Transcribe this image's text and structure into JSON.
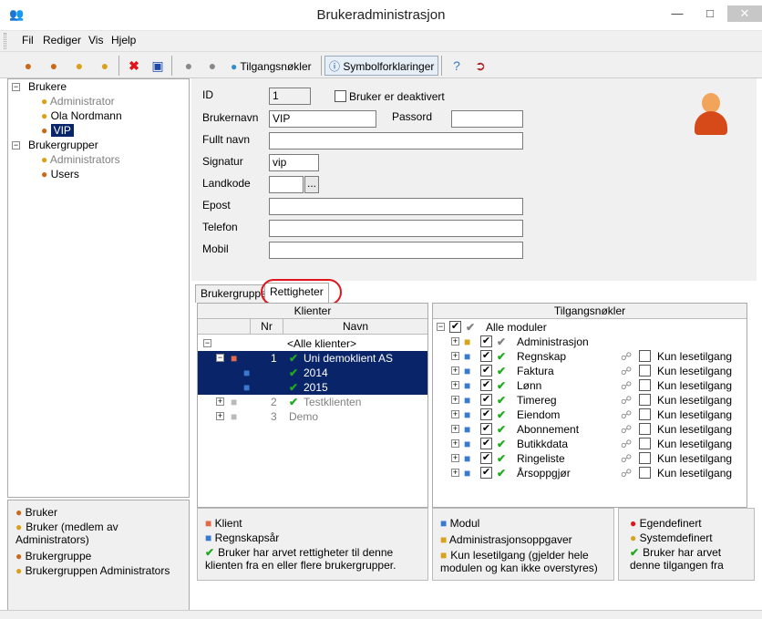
{
  "window": {
    "title": "Brukeradministrasjon"
  },
  "menu": {
    "items": [
      "Fil",
      "Rediger",
      "Vis",
      "Hjelp"
    ]
  },
  "toolbar": {
    "tilgangsnokler": "Tilgangsnøkler",
    "symbolforklaringer": "Symbolforklaringer"
  },
  "tree": {
    "brukere": "Brukere",
    "users": [
      "Administrator",
      "Ola Nordmann",
      "VIP"
    ],
    "brukergrupper": "Brukergrupper",
    "groups": [
      "Administrators",
      "Users"
    ]
  },
  "legend_left": [
    "Bruker",
    "Bruker (medlem av Administrators)",
    "Brukergruppe",
    "Brukergruppen Administrators"
  ],
  "form": {
    "id_label": "ID",
    "id_value": "1",
    "deactivated_label": "Bruker er deaktivert",
    "username_label": "Brukernavn",
    "username_value": "VIP",
    "password_label": "Passord",
    "password_value": "",
    "fullname_label": "Fullt navn",
    "fullname_value": "",
    "signature_label": "Signatur",
    "signature_value": "vip",
    "country_label": "Landkode",
    "country_value": "",
    "email_label": "Epost",
    "email_value": "",
    "phone_label": "Telefon",
    "phone_value": "",
    "mobile_label": "Mobil",
    "mobile_value": "",
    "lookup_btn": "..."
  },
  "tabs": [
    "Brukergrupper",
    "Rettigheter"
  ],
  "clients": {
    "header": "Klienter",
    "col_nr": "Nr",
    "col_navn": "Navn",
    "all": "<Alle klienter>",
    "rows": [
      {
        "nr": "1",
        "name": "Uni demoklient AS"
      },
      {
        "nr": "",
        "name": "2014"
      },
      {
        "nr": "",
        "name": "2015"
      },
      {
        "nr": "2",
        "name": "Testklienten"
      },
      {
        "nr": "3",
        "name": "Demo"
      }
    ]
  },
  "keys": {
    "header": "Tilgangsnøkler",
    "all": "Alle moduler",
    "modules": [
      "Administrasjon",
      "Regnskap",
      "Faktura",
      "Lønn",
      "Timereg",
      "Eiendom",
      "Abonnement",
      "Butikkdata",
      "Ringeliste",
      "Årsoppgjør"
    ],
    "readonly_label": "Kun lesetilgang"
  },
  "legend_bottom": {
    "col1": [
      "Klient",
      "Regnskapsår",
      "Bruker har arvet rettigheter til denne klienten fra en eller flere brukergrupper."
    ],
    "col2": [
      "Modul",
      "Administrasjonsoppgaver",
      "Kun lesetilgang (gjelder hele modulen og kan ikke overstyres)"
    ],
    "col3": [
      "Egendefinert",
      "Systemdefinert",
      "Bruker har arvet denne tilgangen fra"
    ]
  }
}
